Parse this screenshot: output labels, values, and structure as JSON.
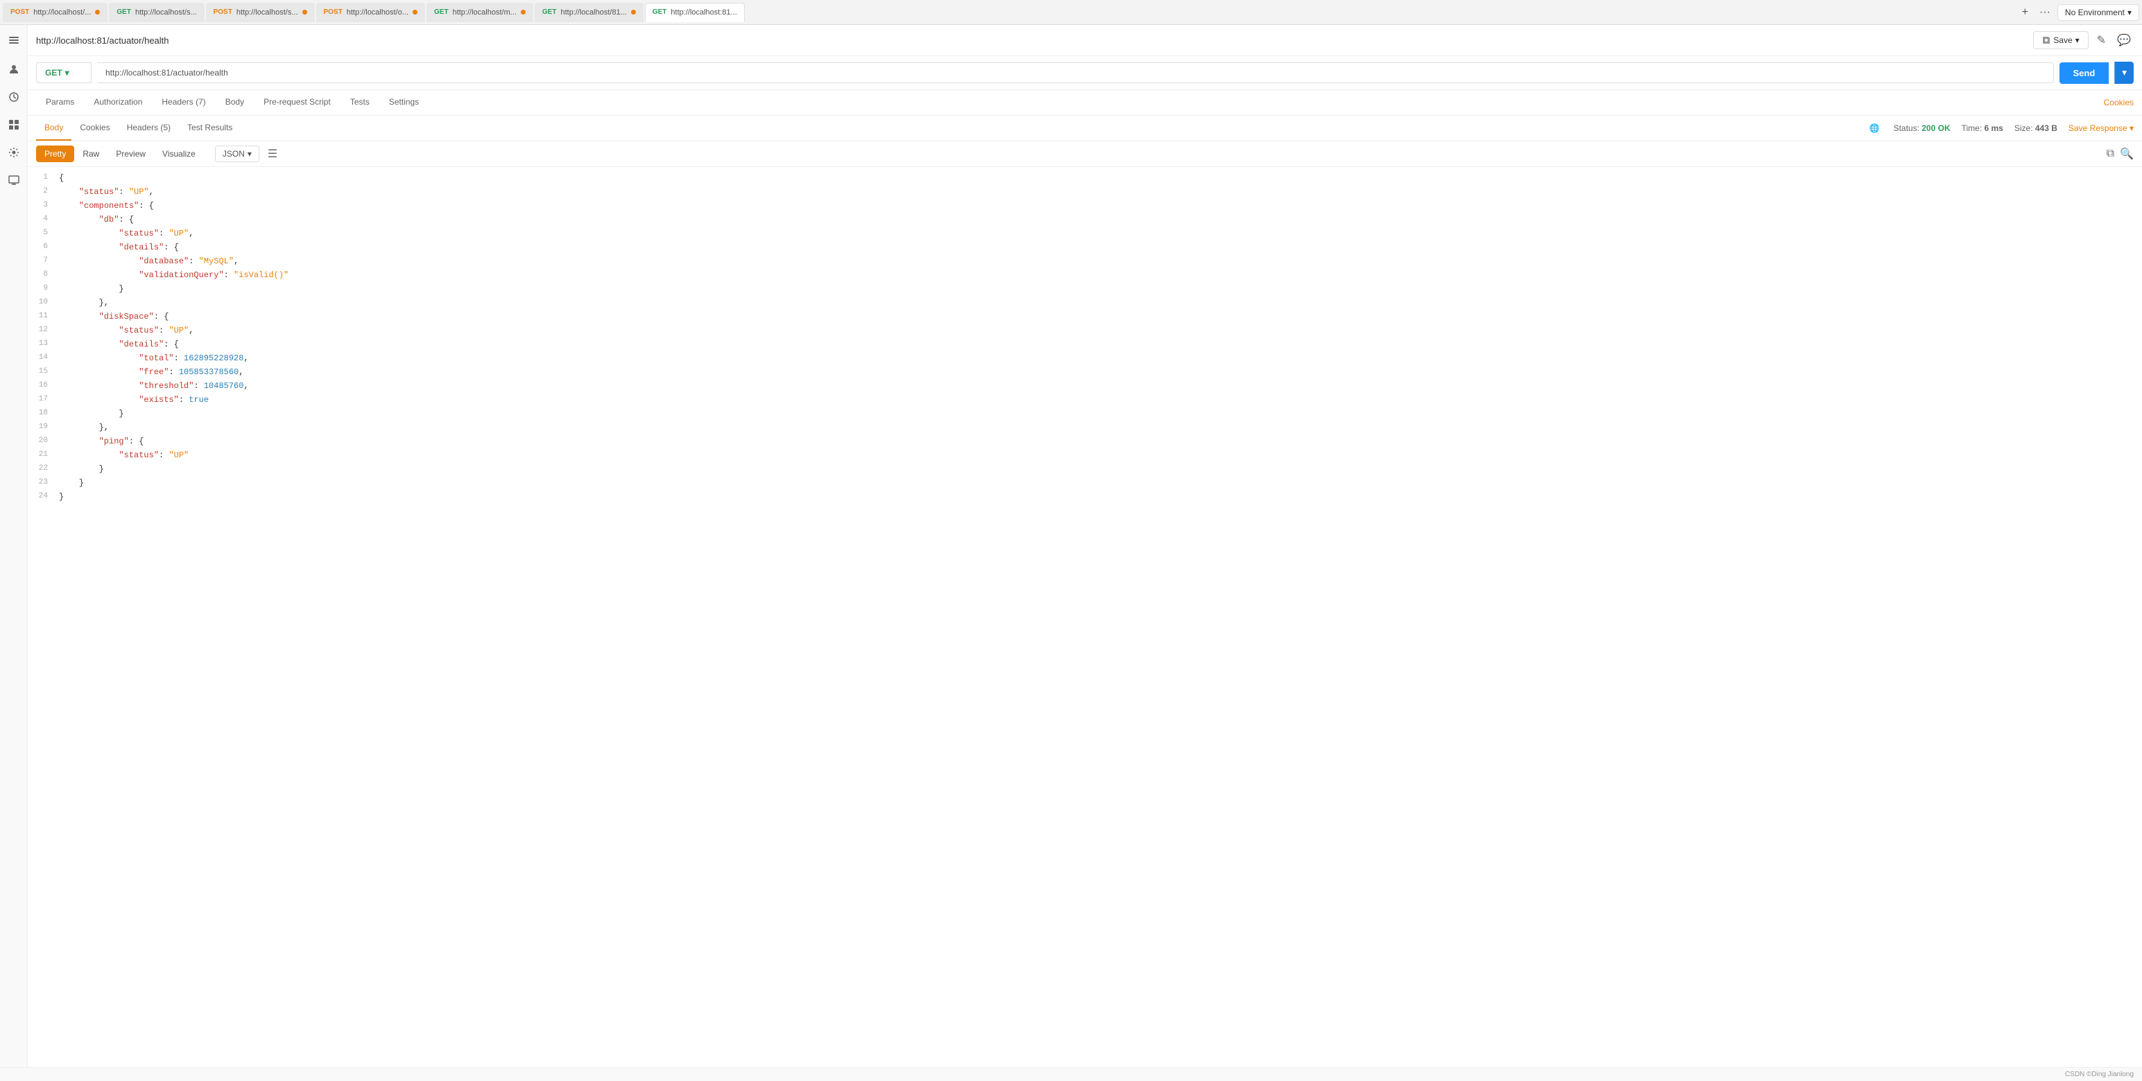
{
  "tabs": [
    {
      "id": "tab1",
      "method": "POST",
      "methodClass": "post",
      "url": "http://localhost/...",
      "hasDot": true,
      "dotClass": "orange",
      "active": false
    },
    {
      "id": "tab2",
      "method": "GET",
      "methodClass": "get",
      "url": "http://localhost/s...",
      "hasDot": false,
      "dotClass": "",
      "active": false
    },
    {
      "id": "tab3",
      "method": "POST",
      "methodClass": "post",
      "url": "http://localhost/s...",
      "hasDot": true,
      "dotClass": "orange",
      "active": false
    },
    {
      "id": "tab4",
      "method": "POST",
      "methodClass": "post",
      "url": "http://localhost/o...",
      "hasDot": true,
      "dotClass": "orange",
      "active": false
    },
    {
      "id": "tab5",
      "method": "GET",
      "methodClass": "get",
      "url": "http://localhost/m...",
      "hasDot": true,
      "dotClass": "orange",
      "active": false
    },
    {
      "id": "tab6",
      "method": "GET",
      "methodClass": "get",
      "url": "http://localhost/81...",
      "hasDot": true,
      "dotClass": "orange",
      "active": false
    },
    {
      "id": "tab7",
      "method": "GET",
      "methodClass": "get",
      "url": "http://localhost:81...",
      "hasDot": false,
      "dotClass": "",
      "active": true
    }
  ],
  "urlBarTitle": "http://localhost:81/actuator/health",
  "saveLabel": "Save",
  "requestMethod": "GET",
  "requestUrl": "http://localhost:81/actuator/health",
  "sendLabel": "Send",
  "requestTabs": [
    {
      "label": "Params",
      "active": false
    },
    {
      "label": "Authorization",
      "active": false
    },
    {
      "label": "Headers (7)",
      "active": false
    },
    {
      "label": "Body",
      "active": false
    },
    {
      "label": "Pre-request Script",
      "active": false
    },
    {
      "label": "Tests",
      "active": false
    },
    {
      "label": "Settings",
      "active": false
    }
  ],
  "cookiesLink": "Cookies",
  "responseTabs": [
    {
      "label": "Body",
      "active": true
    },
    {
      "label": "Cookies",
      "active": false
    },
    {
      "label": "Headers (5)",
      "active": false
    },
    {
      "label": "Test Results",
      "active": false
    }
  ],
  "responseStatus": {
    "statusLabel": "Status:",
    "statusValue": "200 OK",
    "timeLabel": "Time:",
    "timeValue": "6 ms",
    "sizeLabel": "Size:",
    "sizeValue": "443 B",
    "saveResponse": "Save Response"
  },
  "viewTabs": [
    {
      "label": "Pretty",
      "active": true
    },
    {
      "label": "Raw",
      "active": false
    },
    {
      "label": "Preview",
      "active": false
    },
    {
      "label": "Visualize",
      "active": false
    }
  ],
  "formatLabel": "JSON",
  "noEnvironment": "No Environment",
  "bottomBarText": "CSDN ©Ding Jianlong",
  "codeLines": [
    {
      "num": "1",
      "html": "<span class='punct'>{</span>"
    },
    {
      "num": "2",
      "html": "    <span class='str-key'>\"status\"</span><span class='punct'>: </span><span class='str-val'>\"UP\"</span><span class='punct'>,</span>"
    },
    {
      "num": "3",
      "html": "    <span class='str-key'>\"components\"</span><span class='punct'>: {</span>"
    },
    {
      "num": "4",
      "html": "        <span class='str-key'>\"db\"</span><span class='punct'>: {</span>"
    },
    {
      "num": "5",
      "html": "            <span class='str-key'>\"status\"</span><span class='punct'>: </span><span class='str-val'>\"UP\"</span><span class='punct'>,</span>"
    },
    {
      "num": "6",
      "html": "            <span class='str-key'>\"details\"</span><span class='punct'>: {</span>"
    },
    {
      "num": "7",
      "html": "                <span class='str-key'>\"database\"</span><span class='punct'>: </span><span class='str-val'>\"MySQL\"</span><span class='punct'>,</span>"
    },
    {
      "num": "8",
      "html": "                <span class='str-key'>\"validationQuery\"</span><span class='punct'>: </span><span class='str-val'>\"isValid()\"</span>"
    },
    {
      "num": "9",
      "html": "            <span class='punct'>}</span>"
    },
    {
      "num": "10",
      "html": "        <span class='punct'>},</span>"
    },
    {
      "num": "11",
      "html": "        <span class='str-key'>\"diskSpace\"</span><span class='punct'>: {</span>"
    },
    {
      "num": "12",
      "html": "            <span class='str-key'>\"status\"</span><span class='punct'>: </span><span class='str-val'>\"UP\"</span><span class='punct'>,</span>"
    },
    {
      "num": "13",
      "html": "            <span class='str-key'>\"details\"</span><span class='punct'>: {</span>"
    },
    {
      "num": "14",
      "html": "                <span class='str-key'>\"total\"</span><span class='punct'>: </span><span class='num-val'>162895228928</span><span class='punct'>,</span>"
    },
    {
      "num": "15",
      "html": "                <span class='str-key'>\"free\"</span><span class='punct'>: </span><span class='num-val'>105853378560</span><span class='punct'>,</span>"
    },
    {
      "num": "16",
      "html": "                <span class='str-key'>\"threshold\"</span><span class='punct'>: </span><span class='num-val'>10485760</span><span class='punct'>,</span>"
    },
    {
      "num": "17",
      "html": "                <span class='str-key'>\"exists\"</span><span class='punct'>: </span><span class='bool-val'>true</span>"
    },
    {
      "num": "18",
      "html": "            <span class='punct'>}</span>"
    },
    {
      "num": "19",
      "html": "        <span class='punct'>},</span>"
    },
    {
      "num": "20",
      "html": "        <span class='str-key'>\"ping\"</span><span class='punct'>: {</span>"
    },
    {
      "num": "21",
      "html": "            <span class='str-key'>\"status\"</span><span class='punct'>: </span><span class='str-val'>\"UP\"</span>"
    },
    {
      "num": "22",
      "html": "        <span class='punct'>}</span>"
    },
    {
      "num": "23",
      "html": "    <span class='punct'>}</span>"
    },
    {
      "num": "24",
      "html": "<span class='punct'>}</span>"
    }
  ]
}
